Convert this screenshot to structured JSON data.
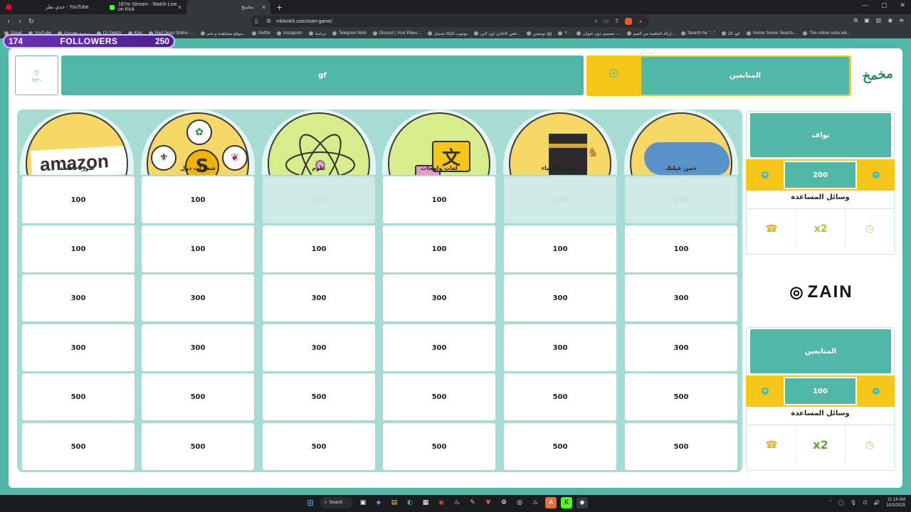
{
  "browser": {
    "tabs": [
      {
        "label": "جدي نطر - YouTube",
        "color": "#ff0033"
      },
      {
        "label": "187m Stream - Watch Live on Kick",
        "color": "#53fc18"
      },
      {
        "label": "مخمخ",
        "color": "#9aa0a6",
        "active": true
      }
    ],
    "url": "mkhmkh.com/start-game/",
    "bookmarks": [
      "Gmail",
      "YouTube",
      "Google ترجمة",
      "(1) Twitch",
      "Kick",
      "Red Dead Online -...",
      "موقع مشاهدة و تحم...",
      "Netflix",
      "Instagram",
      "ترجمة",
      "Telegram Web",
      "Discord | Your Place...",
      "تحميل mp3 يوتيوب",
      "قص الاغاني اون لاين...",
      "توتيشن gg",
      "Y...",
      "تصميم دون عنوان -...",
      "إزالة الخلفية من الصو...",
      "Search for \"...\"",
      "كود 16",
      "Anime Scene Search...",
      "The online code edi..."
    ]
  },
  "followers_widget": {
    "current": "174",
    "label": "FOLLOWERS",
    "goal": "250"
  },
  "top": {
    "back_label": "رجوع",
    "game_name": "gf",
    "active_team_label": "المتابعين",
    "logo_text": "مخمخ"
  },
  "categories": [
    {
      "label": "صورة ناقصة",
      "values": [
        "100",
        "100",
        "300",
        "300",
        "500",
        "500"
      ],
      "used": [
        false,
        false,
        false,
        false,
        false,
        false
      ]
    },
    {
      "label": "شعارات دول",
      "values": [
        "100",
        "100",
        "300",
        "300",
        "500",
        "500"
      ],
      "used": [
        false,
        false,
        false,
        false,
        false,
        false
      ]
    },
    {
      "label": "علوم",
      "values": [
        "100",
        "100",
        "300",
        "300",
        "500",
        "500"
      ],
      "used": [
        true,
        false,
        false,
        false,
        false,
        false
      ]
    },
    {
      "label": "لغات ولهجات",
      "values": [
        "100",
        "100",
        "300",
        "300",
        "500",
        "500"
      ],
      "used": [
        false,
        false,
        false,
        false,
        false,
        false
      ]
    },
    {
      "label": "قصص الأنبياء",
      "values": [
        "100",
        "100",
        "300",
        "300",
        "500",
        "500"
      ],
      "used": [
        true,
        false,
        false,
        false,
        false,
        false
      ]
    },
    {
      "label": "خمن عيلتك",
      "values": [
        "100",
        "100",
        "300",
        "300",
        "500",
        "500"
      ],
      "used": [
        true,
        false,
        false,
        false,
        false,
        false
      ]
    }
  ],
  "teams": [
    {
      "name": "نواف",
      "score": "200",
      "help_title": "وسائل المساعدة",
      "helps": [
        "call-icon",
        "x2",
        "timer-icon"
      ]
    },
    {
      "name": "المتابعين",
      "score": "100",
      "help_title": "وسائل المساعدة",
      "helps": [
        "call-icon",
        "x2",
        "timer-icon"
      ]
    }
  ],
  "sponsor": "ZAIN",
  "taskbar": {
    "search": "Search",
    "time": "11:14 AM",
    "date": "10/3/2025"
  },
  "colors": {
    "teal": "#51b8a8",
    "yellow": "#f5c518",
    "board": "#a7dcd4"
  }
}
